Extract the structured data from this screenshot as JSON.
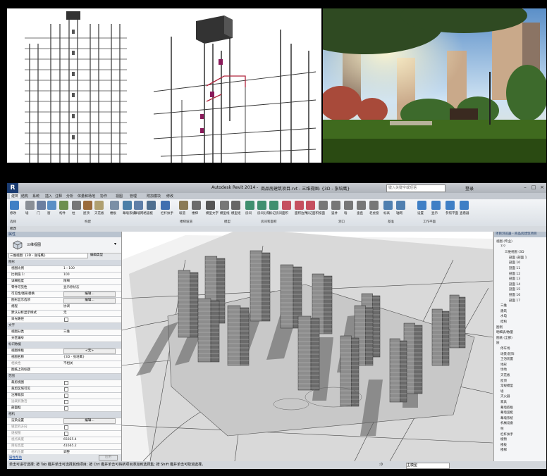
{
  "app": {
    "title": "Autodesk Revit 2014 -",
    "project": "商品房建筑项目.rvt - 三维视图: {3D - 张培鹰}",
    "search_placeholder": "键入关键字或短语",
    "login": "登录"
  },
  "tabs": [
    "建筑",
    "结构",
    "系统",
    "插入",
    "注释",
    "分析",
    "体量和场地",
    "协作",
    "视图",
    "管理",
    "附加模块",
    "修改"
  ],
  "ribbon": {
    "tools": [
      "修改",
      "墙",
      "门",
      "窗",
      "构件",
      "柱",
      "屋顶",
      "天花板",
      "楼板",
      "幕墙系统",
      "幕墙网格",
      "竖梃",
      "栏杆扶手",
      "坡道",
      "楼梯",
      "模型文字",
      "模型线",
      "模型组",
      "房间",
      "房间分隔",
      "标记房间",
      "面积",
      "面积边界",
      "标记面积",
      "按面",
      "竖井",
      "墙",
      "垂直",
      "老虎窗",
      "标高",
      "轴网",
      "设置",
      "显示",
      "参照平面",
      "查看器"
    ],
    "panels": [
      "选择",
      "构建",
      "楼梯坡道",
      "模型",
      "房间和面积",
      "洞口",
      "基准",
      "工作平面"
    ]
  },
  "option_bar": {
    "select": "修改"
  },
  "properties": {
    "header": "属性",
    "type_name": "三维视图",
    "view_select": "三维视图: {3D - 张培鹰}",
    "edit_type": "编辑类型",
    "rows": [
      {
        "k": "图形",
        "v": "",
        "sec": true
      },
      {
        "k": "视图比例",
        "v": "1 : 100"
      },
      {
        "k": "比例值 1:",
        "v": "100"
      },
      {
        "k": "详细程度",
        "v": "精细"
      },
      {
        "k": "零件可见性",
        "v": "显示原状态"
      },
      {
        "k": "可见性/图形替换",
        "v": "编辑...",
        "ed": true
      },
      {
        "k": "图形显示选项",
        "v": "编辑...",
        "ed": true
      },
      {
        "k": "规程",
        "v": "协调"
      },
      {
        "k": "默认分析显示样式",
        "v": "无"
      },
      {
        "k": "日光路径",
        "v": "",
        "cb": true
      },
      {
        "k": "文字",
        "v": "",
        "sec": true
      },
      {
        "k": "视图分类",
        "v": "三维"
      },
      {
        "k": "分区编号",
        "v": ""
      },
      {
        "k": "标识数据",
        "v": "",
        "sec": true
      },
      {
        "k": "视图样板",
        "v": "<无>",
        "ed": true
      },
      {
        "k": "视图名称",
        "v": "{3D - 张培鹰}"
      },
      {
        "k": "相关性",
        "v": "不相关",
        "dis": true
      },
      {
        "k": "图纸上的标题",
        "v": ""
      },
      {
        "k": "范围",
        "v": "",
        "sec": true
      },
      {
        "k": "裁剪视图",
        "v": "",
        "cb": true
      },
      {
        "k": "裁剪区域可见",
        "v": "",
        "cb": true
      },
      {
        "k": "注释裁剪",
        "v": "",
        "cb": true
      },
      {
        "k": "远裁剪激活",
        "v": "",
        "cb": true,
        "dis": true
      },
      {
        "k": "剖面框",
        "v": "",
        "cb": true
      },
      {
        "k": "相机",
        "v": "",
        "sec": true
      },
      {
        "k": "渲染设置",
        "v": "编辑...",
        "ed": true
      },
      {
        "k": "锁定的方向",
        "v": "",
        "cb": true,
        "dis": true
      },
      {
        "k": "透视图",
        "v": "",
        "cb": true,
        "dis": true
      },
      {
        "k": "视点高度",
        "v": "65025.4",
        "dis": true
      },
      {
        "k": "目标高度",
        "v": "41665.2",
        "dis": true
      },
      {
        "k": "相机位置",
        "v": "调整",
        "dis": true
      },
      {
        "k": "阶段化",
        "v": "",
        "sec": true
      },
      {
        "k": "阶段过滤器",
        "v": "全部显示"
      }
    ],
    "help": "属性帮助",
    "apply": "应用"
  },
  "browser": {
    "header": "项目浏览器 - 商品房建筑项目",
    "nodes": [
      {
        "t": "视图 (专业)",
        "d": 0
      },
      {
        "t": "???",
        "d": 1
      },
      {
        "t": "三维视图 (3D",
        "d": 2
      },
      {
        "t": "剖面 (剖面 1",
        "d": 3
      },
      {
        "t": "剖面 10",
        "d": 3
      },
      {
        "t": "剖面 11",
        "d": 3
      },
      {
        "t": "剖面 12",
        "d": 3
      },
      {
        "t": "剖面 13",
        "d": 3
      },
      {
        "t": "剖面 14",
        "d": 3
      },
      {
        "t": "剖面 15",
        "d": 3
      },
      {
        "t": "剖面 16",
        "d": 3
      },
      {
        "t": "剖面 17",
        "d": 3
      },
      {
        "t": "三维",
        "d": 1
      },
      {
        "t": "建筑",
        "d": 1
      },
      {
        "t": "水电",
        "d": 1
      },
      {
        "t": "结构",
        "d": 1
      },
      {
        "t": "图例",
        "d": 0
      },
      {
        "t": "明细表/数量",
        "d": 0
      },
      {
        "t": "图纸 (全部)",
        "d": 0
      },
      {
        "t": "族",
        "d": 0
      },
      {
        "t": "停车场",
        "d": 1
      },
      {
        "t": "场景/装饰",
        "d": 1
      },
      {
        "t": "卫浴装置",
        "d": 1
      },
      {
        "t": "地形",
        "d": 1
      },
      {
        "t": "场地",
        "d": 1
      },
      {
        "t": "天花板",
        "d": 1
      },
      {
        "t": "屋顶",
        "d": 1
      },
      {
        "t": "常规模型",
        "d": 1
      },
      {
        "t": "墙",
        "d": 1
      },
      {
        "t": "灭火器",
        "d": 1
      },
      {
        "t": "家具",
        "d": 1
      },
      {
        "t": "幕墙嵌板",
        "d": 1
      },
      {
        "t": "幕墙竖梃",
        "d": 1
      },
      {
        "t": "幕墙系统",
        "d": 1
      },
      {
        "t": "机械设备",
        "d": 1
      },
      {
        "t": "柱",
        "d": 1
      },
      {
        "t": "栏杆扶手",
        "d": 1
      },
      {
        "t": "植物",
        "d": 1
      },
      {
        "t": "楼板",
        "d": 1
      },
      {
        "t": "楼梯",
        "d": 1
      }
    ]
  },
  "status": {
    "hint": "单击可进行选择; 按 Tab 键并单击可选择其他项目; 按 Ctrl 键并单击可将新项目添加到选择集; 按 Shift 键并单击可取消选择。",
    "zero": ":0",
    "model": "主模型"
  }
}
